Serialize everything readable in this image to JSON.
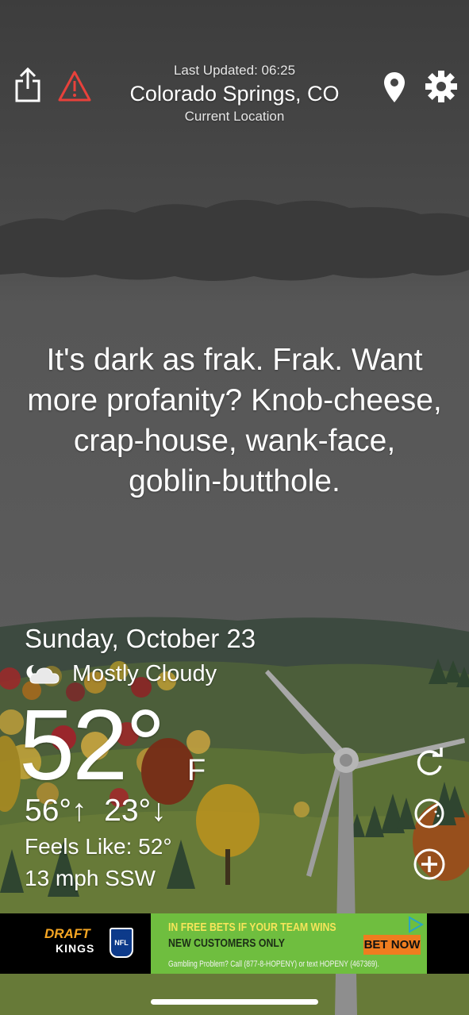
{
  "header": {
    "last_updated": "Last Updated: 06:25",
    "location": "Colorado Springs, CO",
    "location_sub": "Current Location"
  },
  "quip": "It's dark as frak. Frak. Want more profanity? Knob-cheese, crap-house, wank-face, goblin-butthole.",
  "weather": {
    "date": "Sunday, October 23",
    "condition": "Mostly Cloudy",
    "temperature": "52°",
    "unit": "F",
    "hi_lo": "56°↑  23°↓",
    "feels_like": "Feels Like: 52°",
    "wind": "13 mph SSW"
  },
  "icons": {
    "share": "share-icon",
    "alert": "alert-triangle-icon",
    "location": "location-pin-icon",
    "settings": "gear-icon",
    "condition": "partly-cloudy-night-icon",
    "refresh": "refresh-icon",
    "radar": "radar-icon",
    "add": "add-icon"
  },
  "ad": {
    "brand_line1": "DRAFT",
    "brand_line2": "KINGS",
    "league": "NFL",
    "headline": "IN FREE BETS IF YOUR TEAM WINS",
    "subline": "NEW CUSTOMERS ONLY",
    "disclaimer": "Gambling Problem? Call (877-8-HOPENY) or text HOPENY (467369).",
    "cta": "BET NOW",
    "colors": {
      "ad_green": "#6fbe3f",
      "cta_orange": "#ef7d1f",
      "headline_yellow": "#f6e55a"
    }
  },
  "colors": {
    "sky_top": "#3f3f3f",
    "sky_mid": "#5a5a5a",
    "alert_red": "#e8413b"
  }
}
